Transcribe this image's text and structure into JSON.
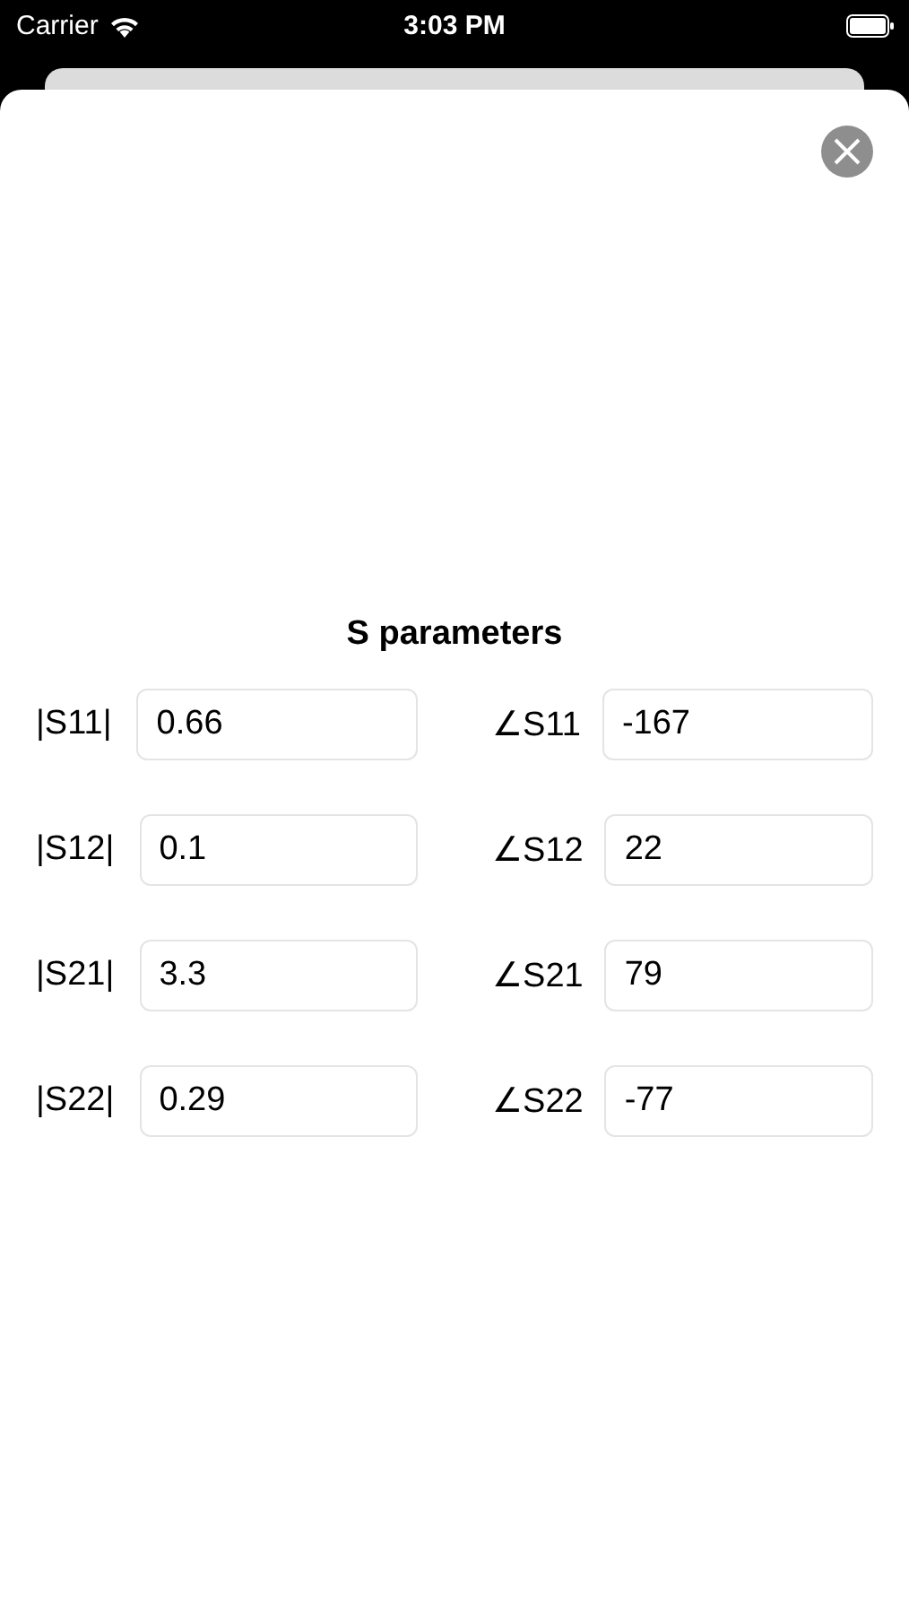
{
  "status_bar": {
    "carrier": "Carrier",
    "time": "3:03 PM"
  },
  "title": "S parameters",
  "rows": [
    {
      "magnitude": {
        "label": "|S11|",
        "value": "0.66"
      },
      "angle": {
        "label": "∠S11",
        "value": "-167"
      }
    },
    {
      "magnitude": {
        "label": "|S12|",
        "value": "0.1"
      },
      "angle": {
        "label": "∠S12",
        "value": "22"
      }
    },
    {
      "magnitude": {
        "label": "|S21|",
        "value": "3.3"
      },
      "angle": {
        "label": "∠S21",
        "value": "79"
      }
    },
    {
      "magnitude": {
        "label": "|S22|",
        "value": "0.29"
      },
      "angle": {
        "label": "∠S22",
        "value": "-77"
      }
    }
  ]
}
